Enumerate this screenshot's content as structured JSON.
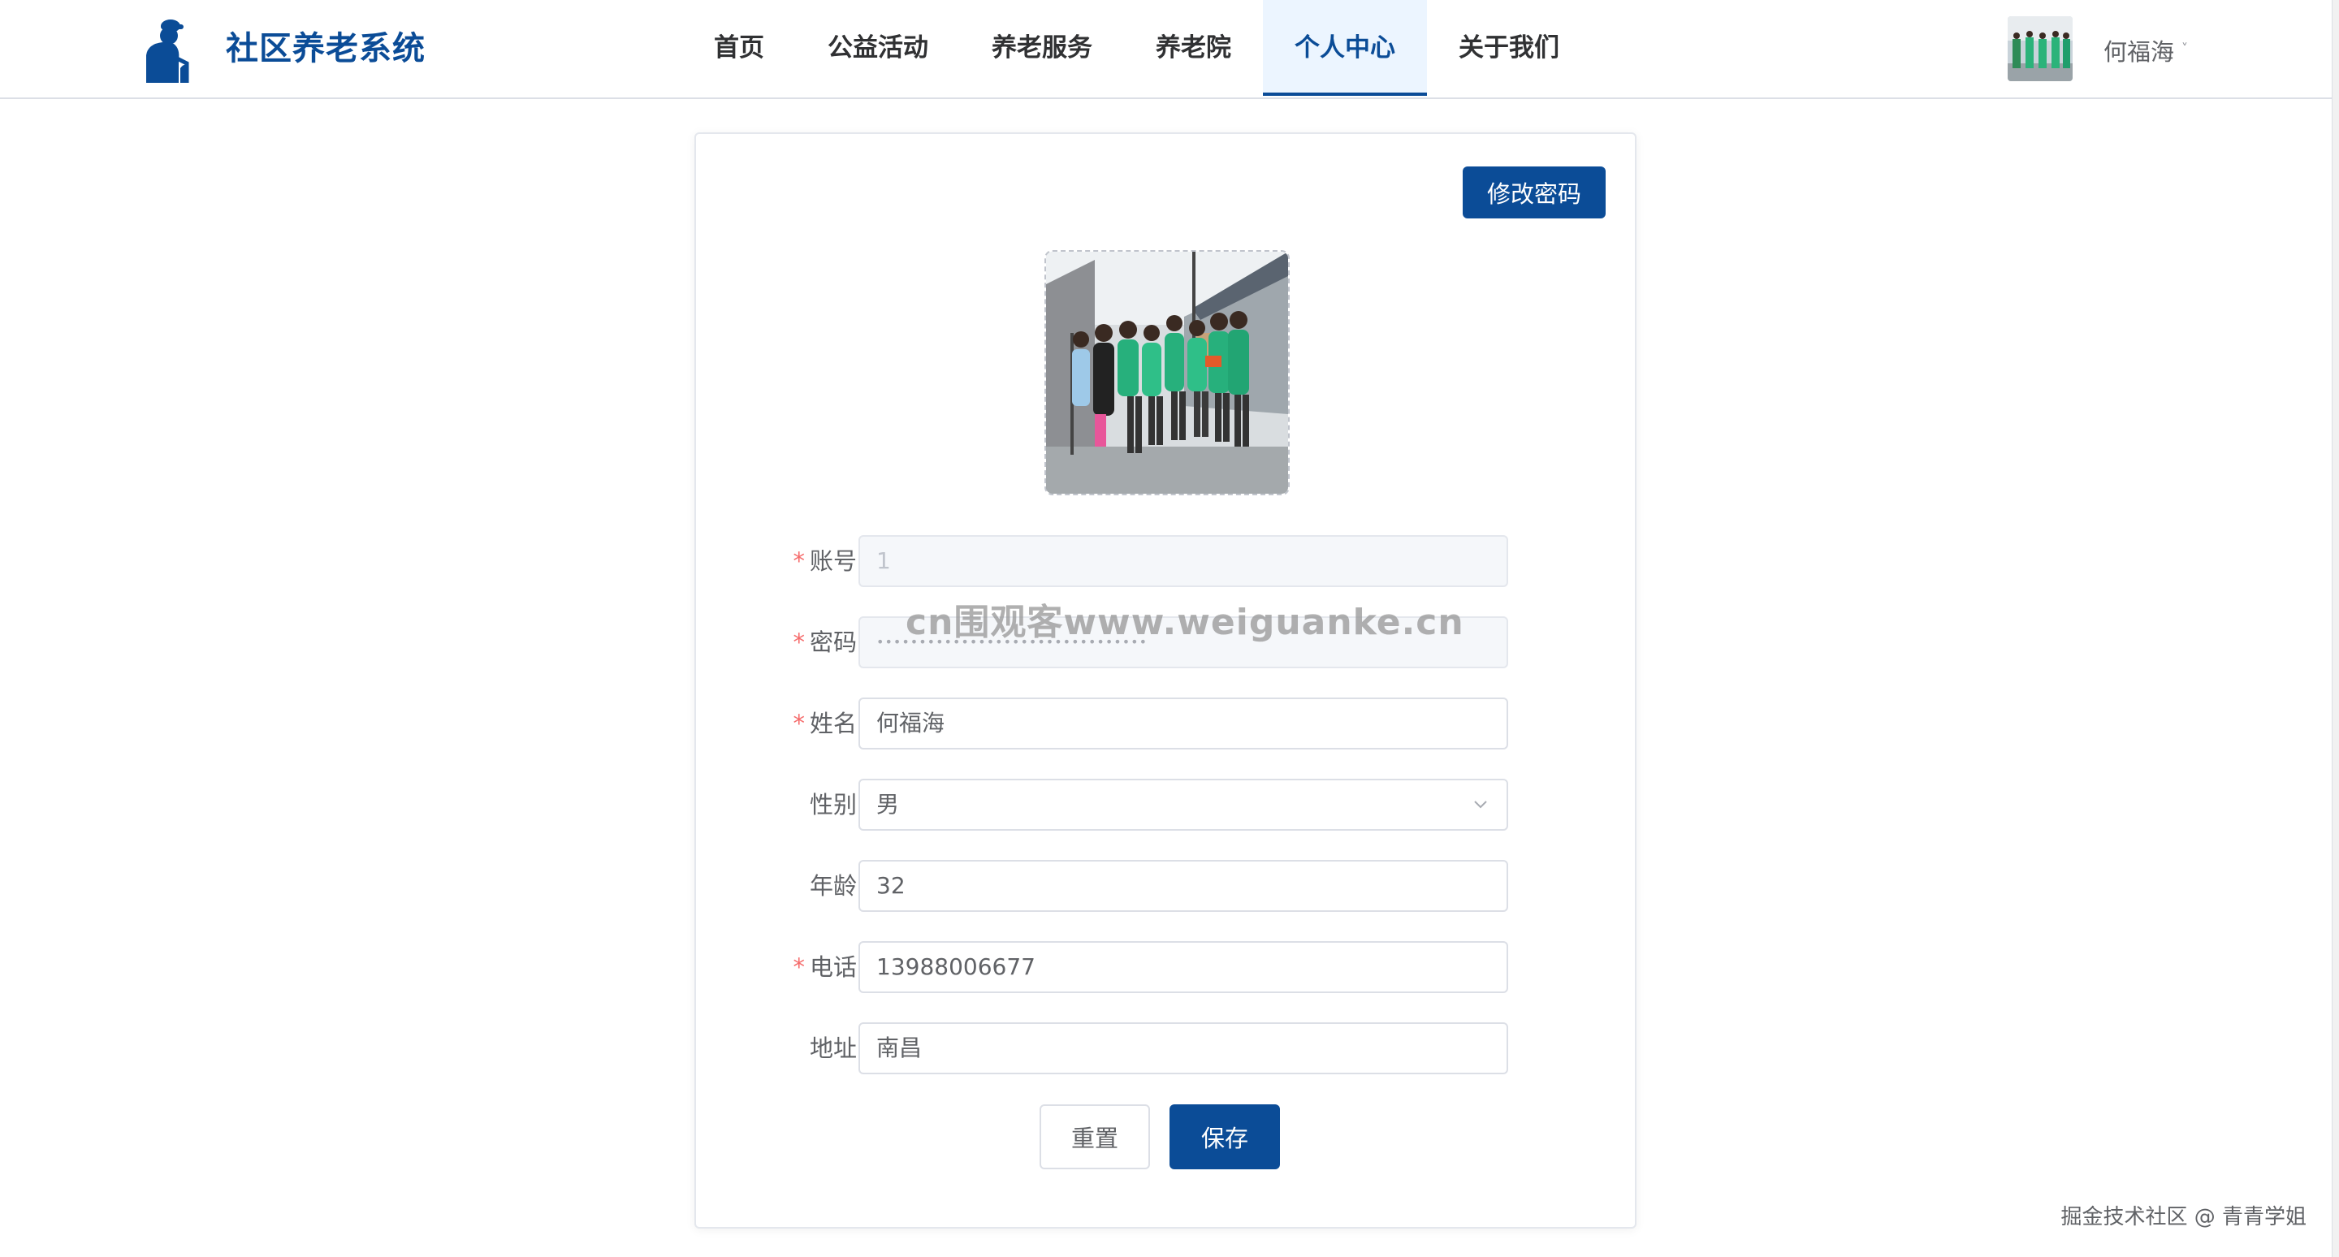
{
  "brand": {
    "title": "社区养老系统",
    "color": "#0b4c97",
    "logo_icon": "elderly-person-icon"
  },
  "nav": {
    "items": [
      {
        "label": "首页"
      },
      {
        "label": "公益活动"
      },
      {
        "label": "养老服务"
      },
      {
        "label": "养老院"
      },
      {
        "label": "个人中心",
        "active": true
      },
      {
        "label": "关于我们"
      }
    ]
  },
  "user": {
    "name": "何福海",
    "caret": "˅",
    "avatar_icon": "user-photo-avatar"
  },
  "profile": {
    "change_password_label": "修改密码",
    "avatar_icon": "volunteers-photo",
    "fields": {
      "account": {
        "label": "账号",
        "required": true,
        "value": "1",
        "disabled": true
      },
      "password": {
        "label": "密码",
        "required": true,
        "value": "••••••••••••••••••••••••••••••••",
        "disabled": true
      },
      "name": {
        "label": "姓名",
        "required": true,
        "value": "何福海"
      },
      "gender": {
        "label": "性别",
        "required": false,
        "value": "男"
      },
      "age": {
        "label": "年龄",
        "required": false,
        "value": "32"
      },
      "phone": {
        "label": "电话",
        "required": true,
        "value": "13988006677"
      },
      "address": {
        "label": "地址",
        "required": false,
        "value": "南昌"
      }
    },
    "required_mark": "*",
    "reset_label": "重置",
    "save_label": "保存"
  },
  "watermark": "cn围观客www.weiguanke.cn",
  "footer_mark": "掘金技术社区 @ 青青学姐"
}
